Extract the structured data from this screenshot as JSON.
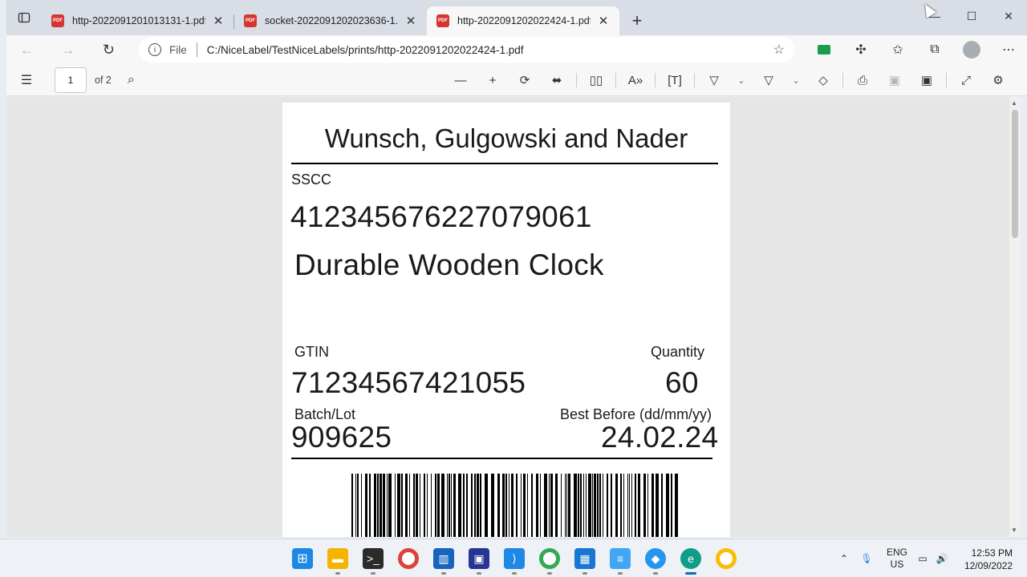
{
  "browser": {
    "tabs": [
      {
        "title": "http-2022091201013131-1.pdf",
        "active": false
      },
      {
        "title": "socket-2022091202023636-1.pdf",
        "active": false
      },
      {
        "title": "http-2022091202022424-1.pdf",
        "active": true
      }
    ],
    "address": {
      "scheme_label": "File",
      "url": "C:/NiceLabel/TestNiceLabels/prints/http-2022091202022424-1.pdf"
    }
  },
  "pdf_toolbar": {
    "page_number": "1",
    "page_count_label": "of 2"
  },
  "label": {
    "company": "Wunsch, Gulgowski and Nader",
    "sscc_label": "SSCC",
    "sscc": "412345676227079061",
    "product": "Durable Wooden Clock",
    "gtin_label": "GTIN",
    "gtin": "71234567421055",
    "quantity_label": "Quantity",
    "quantity": "60",
    "batch_label": "Batch/Lot",
    "batch": "909625",
    "best_before_label": "Best Before (dd/mm/yy)",
    "best_before": "24.02.24"
  },
  "taskbar": {
    "language_line1": "ENG",
    "language_line2": "US",
    "time": "12:53 PM",
    "date": "12/09/2022"
  },
  "colors": {
    "pdf_icon": "#d6342f",
    "accent": "#0f6cbd"
  }
}
